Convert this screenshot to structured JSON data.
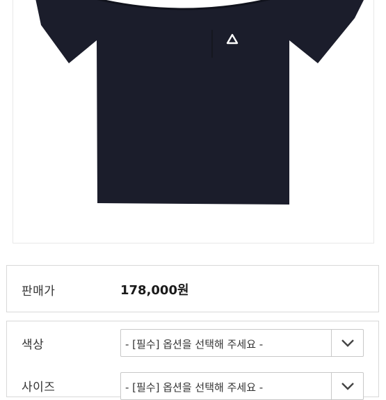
{
  "product": {
    "image_alt": "black t-shirt with triangle logo"
  },
  "price_row": {
    "label": "판매가",
    "value": "178,000원"
  },
  "options": [
    {
      "label": "색상",
      "placeholder": "- [필수] 옵션을 선택해 주세요 -"
    },
    {
      "label": "사이즈",
      "placeholder": "- [필수] 옵션을 선택해 주세요 -"
    }
  ],
  "colors": {
    "shirt": "#1b1d2b",
    "border": "#d8d8d8",
    "logo": "#ffffff"
  },
  "icons": {
    "select_arrow": "chevron-down-icon"
  }
}
